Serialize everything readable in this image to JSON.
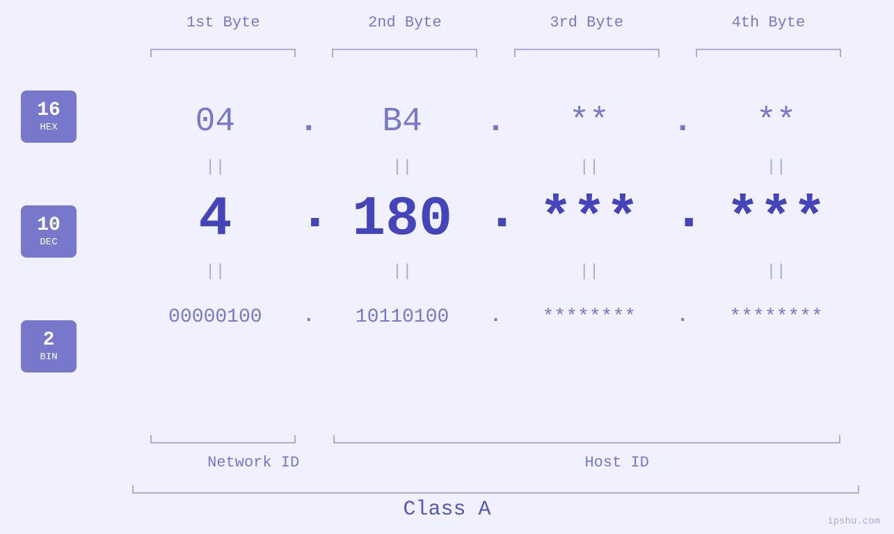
{
  "headers": {
    "byte1": "1st Byte",
    "byte2": "2nd Byte",
    "byte3": "3rd Byte",
    "byte4": "4th Byte"
  },
  "bases": [
    {
      "number": "16",
      "name": "HEX"
    },
    {
      "number": "10",
      "name": "DEC"
    },
    {
      "number": "2",
      "name": "BIN"
    }
  ],
  "rows": {
    "hex": {
      "b1": "04",
      "b2": "B4",
      "b3": "**",
      "b4": "**"
    },
    "dec": {
      "b1": "4",
      "b2": "180",
      "b3": "***",
      "b4": "***"
    },
    "bin": {
      "b1": "00000100",
      "b2": "10110100",
      "b3": "********",
      "b4": "********"
    }
  },
  "labels": {
    "networkId": "Network ID",
    "hostId": "Host ID",
    "classA": "Class A"
  },
  "watermark": "ipshu.com"
}
